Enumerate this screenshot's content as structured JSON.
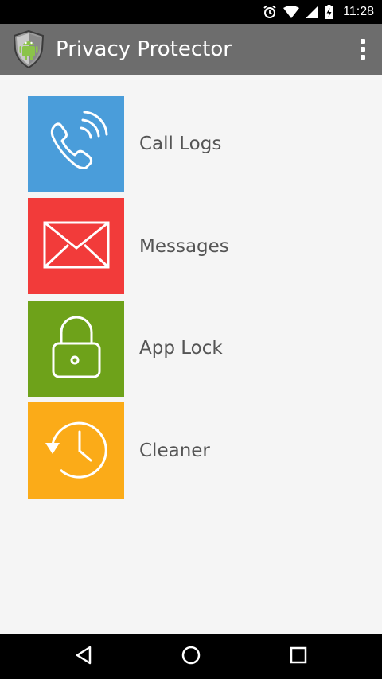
{
  "status_bar": {
    "time": "11:28",
    "icons": [
      "alarm-icon",
      "wifi-icon",
      "signal-icon",
      "battery-charging-icon"
    ]
  },
  "app_bar": {
    "title": "Privacy Protector",
    "logo_icon": "shield-android-logo",
    "overflow_icon": "more-vert-icon"
  },
  "menu": {
    "items": [
      {
        "label": "Call Logs",
        "icon": "phone-call-icon",
        "color": "#4a9dda"
      },
      {
        "label": "Messages",
        "icon": "envelope-icon",
        "color": "#f23b3a"
      },
      {
        "label": "App Lock",
        "icon": "padlock-icon",
        "color": "#6ea21a"
      },
      {
        "label": "Cleaner",
        "icon": "history-clock-icon",
        "color": "#fbab18"
      }
    ]
  },
  "nav_bar": {
    "back_icon": "back-icon",
    "home_icon": "home-icon",
    "recents_icon": "recents-icon"
  },
  "colors": {
    "status_bar": "#000000",
    "app_bar": "#6d6d6d",
    "background": "#f5f5f5",
    "label_text": "#555555"
  }
}
